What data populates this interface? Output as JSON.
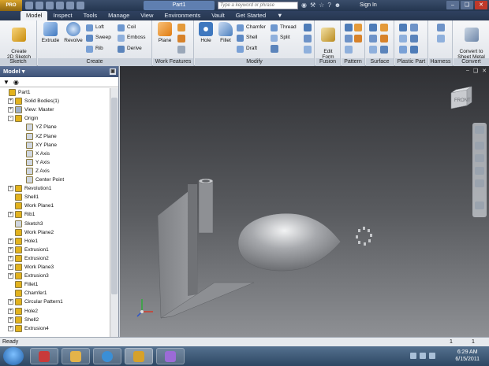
{
  "titlebar": {
    "logo": "PRO",
    "document_title": "Part1",
    "search_placeholder": "Type a keyword or phrase",
    "sign_in": "Sign In"
  },
  "menu": {
    "tabs": [
      "Model",
      "Inspect",
      "Tools",
      "Manage",
      "View",
      "Environments",
      "Vault",
      "Get Started"
    ],
    "active": "Model"
  },
  "ribbon": {
    "sketch": {
      "label": "Sketch",
      "create_2d_sketch": "Create\n2D Sketch"
    },
    "create": {
      "label": "Create",
      "extrude": "Extrude",
      "revolve": "Revolve",
      "loft": "Loft",
      "sweep": "Sweep",
      "rib": "Rib",
      "coil": "Coil",
      "emboss": "Emboss",
      "derive": "Derive"
    },
    "work_features": {
      "label": "Work Features",
      "plane": "Plane"
    },
    "modify": {
      "label": "Modify",
      "hole": "Hole",
      "fillet": "Fillet",
      "chamfer": "Chamfer",
      "shell": "Shell",
      "draft": "Draft",
      "thread": "Thread",
      "split": "Split"
    },
    "fusion": {
      "label": "Fusion",
      "edit_form": "Edit\nForm"
    },
    "pattern": {
      "label": "Pattern"
    },
    "surface": {
      "label": "Surface"
    },
    "plastic_part": {
      "label": "Plastic Part"
    },
    "harness": {
      "label": "Harness"
    },
    "convert": {
      "label": "Convert",
      "convert_to_sheet_metal": "Convert to\nSheet Metal"
    }
  },
  "browser": {
    "title": "Model",
    "tree": [
      {
        "label": "Part1",
        "expander": "",
        "icon": "part-icon"
      },
      {
        "label": "Solid Bodies(1)",
        "expander": "+",
        "icon": "solid-bodies-icon"
      },
      {
        "label": "View: Master",
        "expander": "+",
        "icon": "view-icon"
      },
      {
        "label": "Origin",
        "expander": "-",
        "icon": "origin-folder-icon"
      },
      {
        "label": "YZ Plane",
        "expander": "",
        "icon": "plane-icon"
      },
      {
        "label": "XZ Plane",
        "expander": "",
        "icon": "plane-icon"
      },
      {
        "label": "XY Plane",
        "expander": "",
        "icon": "plane-icon"
      },
      {
        "label": "X Axis",
        "expander": "",
        "icon": "axis-icon"
      },
      {
        "label": "Y Axis",
        "expander": "",
        "icon": "axis-icon"
      },
      {
        "label": "Z Axis",
        "expander": "",
        "icon": "axis-icon"
      },
      {
        "label": "Center Point",
        "expander": "",
        "icon": "point-icon"
      },
      {
        "label": "Revolution1",
        "expander": "+",
        "icon": "revolve-feature-icon"
      },
      {
        "label": "Shell1",
        "expander": "",
        "icon": "shell-feature-icon"
      },
      {
        "label": "Work Plane1",
        "expander": "",
        "icon": "work-plane-icon"
      },
      {
        "label": "Rib1",
        "expander": "+",
        "icon": "rib-feature-icon"
      },
      {
        "label": "Sketch3",
        "expander": "",
        "icon": "sketch-icon"
      },
      {
        "label": "Work Plane2",
        "expander": "",
        "icon": "work-plane-icon"
      },
      {
        "label": "Hole1",
        "expander": "+",
        "icon": "hole-feature-icon"
      },
      {
        "label": "Extrusion1",
        "expander": "+",
        "icon": "extrusion-feature-icon"
      },
      {
        "label": "Extrusion2",
        "expander": "+",
        "icon": "extrusion-feature-icon"
      },
      {
        "label": "Work Plane3",
        "expander": "+",
        "icon": "work-plane-icon"
      },
      {
        "label": "Extrusion3",
        "expander": "+",
        "icon": "extrusion-feature-icon"
      },
      {
        "label": "Fillet1",
        "expander": "",
        "icon": "fillet-feature-icon"
      },
      {
        "label": "Chamfer1",
        "expander": "",
        "icon": "chamfer-feature-icon"
      },
      {
        "label": "Circular Pattern1",
        "expander": "+",
        "icon": "pattern-feature-icon"
      },
      {
        "label": "Hole2",
        "expander": "+",
        "icon": "hole-feature-icon"
      },
      {
        "label": "Shell2",
        "expander": "+",
        "icon": "shell-feature-icon"
      },
      {
        "label": "Extrusion4",
        "expander": "+",
        "icon": "extrusion-feature-icon"
      }
    ]
  },
  "viewport": {
    "viewcube_face": "FRONT"
  },
  "status": {
    "text": "Ready",
    "count1": "1",
    "count2": "1"
  },
  "taskbar": {
    "time": "6:29 AM",
    "date": "6/15/2011"
  },
  "colors": {
    "accent": "#3f5377",
    "feature_yellow": "#e2b21e",
    "model_gray": "#a8aaad"
  }
}
